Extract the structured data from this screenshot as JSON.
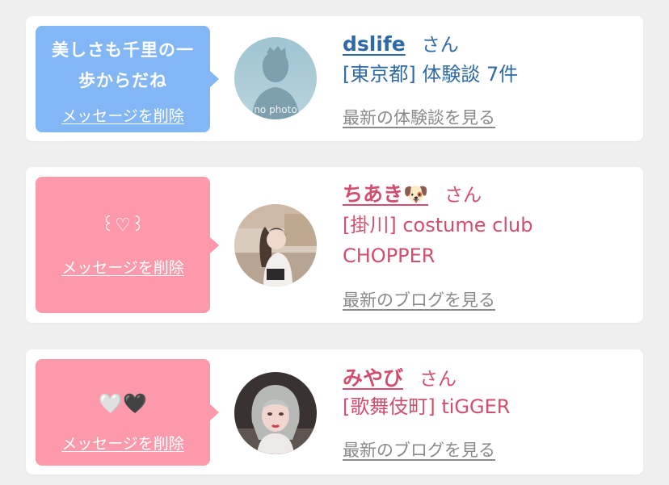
{
  "colors": {
    "blue_bubble": "#82b6f4",
    "pink_bubble": "#fc9aac",
    "blue_text": "#2f6aa6",
    "pink_text": "#d24e6f",
    "link_gray": "#8a8a8a"
  },
  "cards": [
    {
      "bubble_message": "美しさも千里の一歩からだね",
      "bubble_line1": "美しさも千里の一",
      "bubble_line2": "歩からだね",
      "delete_label": "メッセージを削除",
      "avatar_label": "no photo",
      "name": "dslife",
      "honorific": "さん",
      "detail": "[東京都] 体験談 7件",
      "more_link": "最新の体験談を見る"
    },
    {
      "bubble_message": "꒰♡꒱",
      "delete_label": "メッセージを削除",
      "name": "ちあき🐶",
      "honorific": "さん",
      "detail_line1": "[掛川] costume club",
      "detail_line2": "CHOPPER",
      "more_link": "最新のブログを見る"
    },
    {
      "bubble_message": "🤍🖤",
      "delete_label": "メッセージを削除",
      "name": "みやび",
      "honorific": "さん",
      "detail": "[歌舞伎町] tiGGER",
      "more_link": "最新のブログを見る"
    }
  ]
}
